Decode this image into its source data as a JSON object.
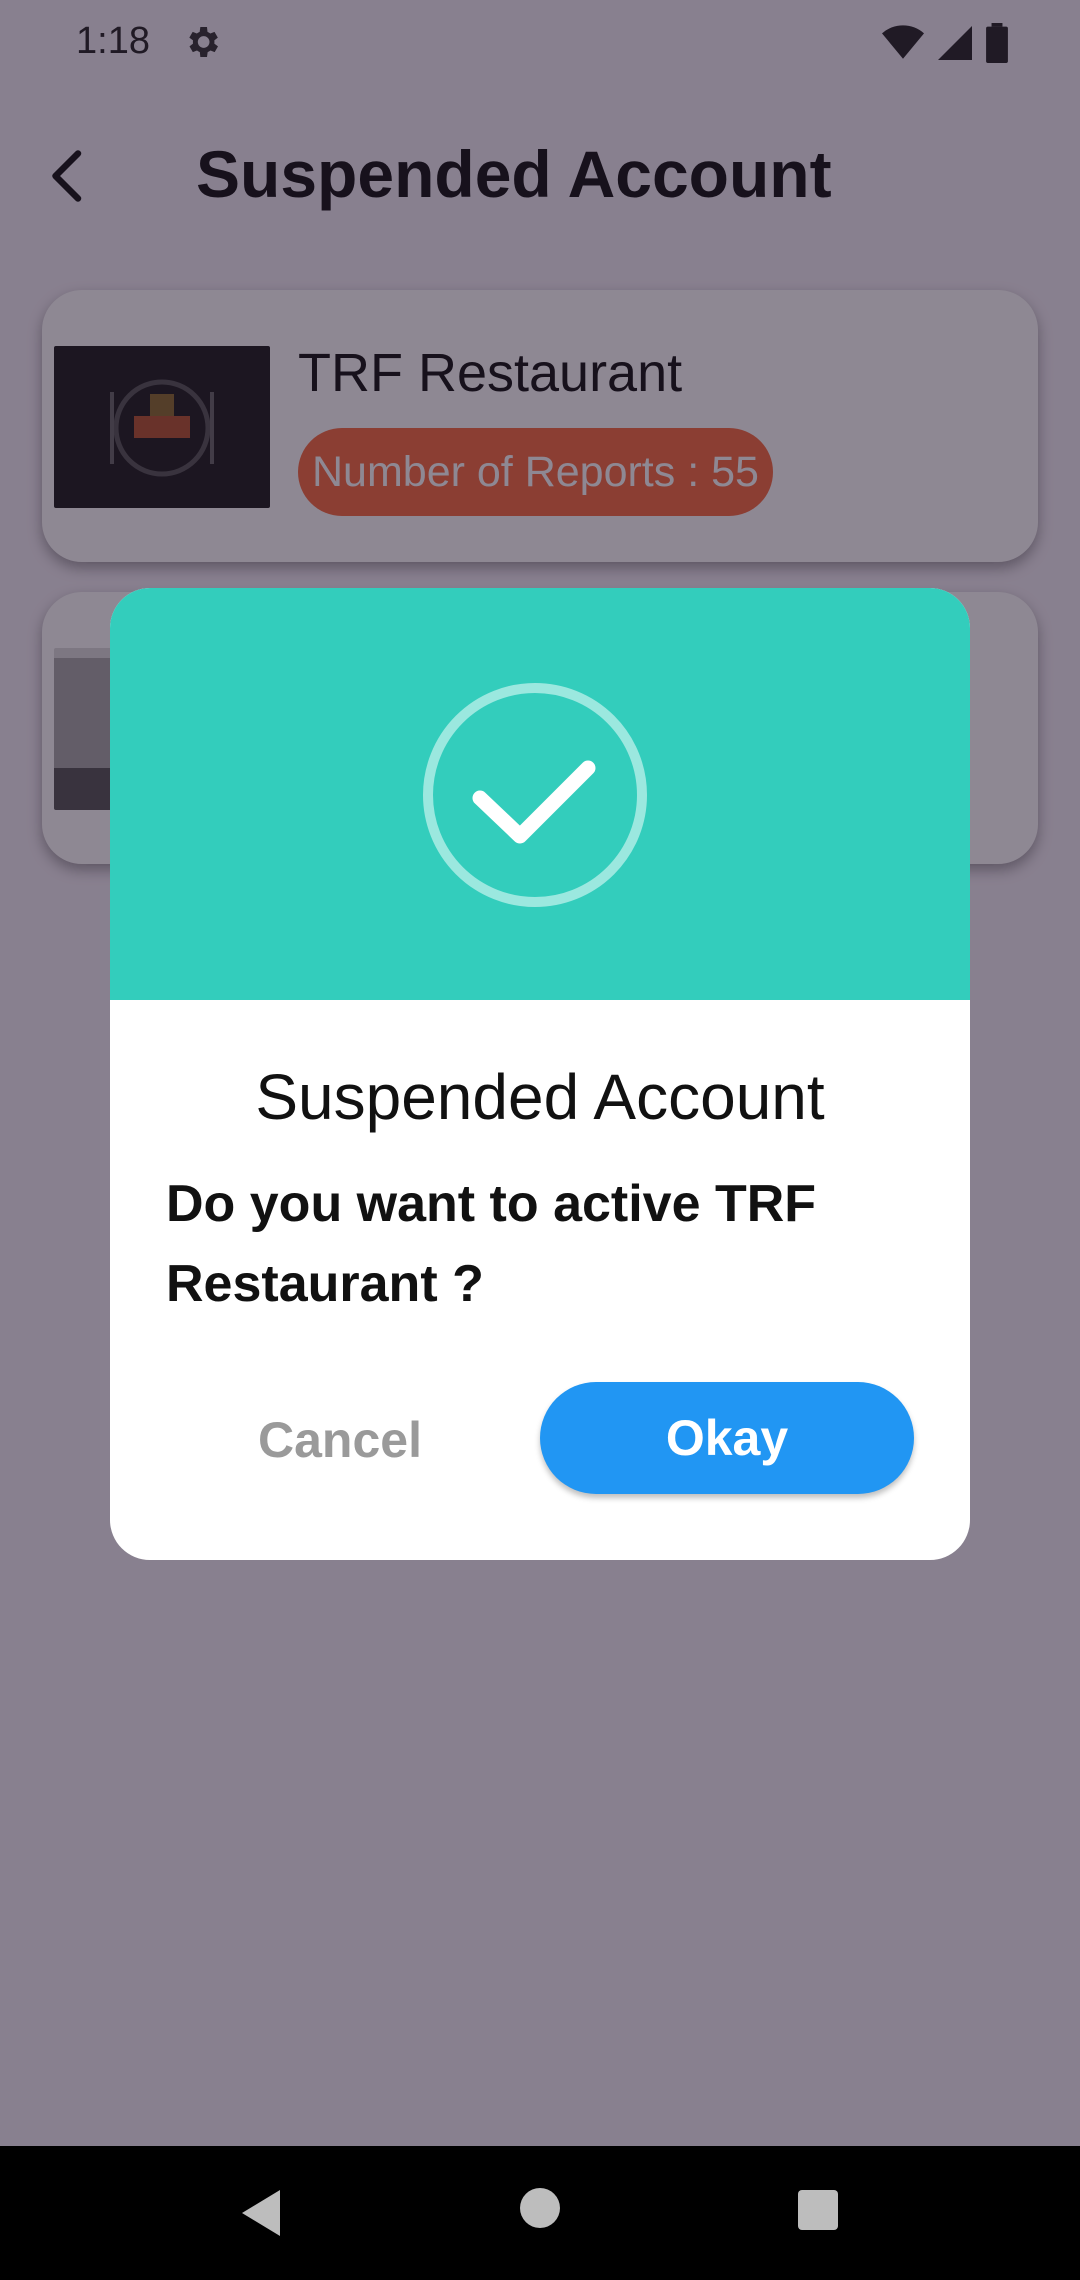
{
  "status_bar": {
    "time": "1:18",
    "icons": [
      "gear-icon",
      "wifi-icon",
      "signal-icon",
      "battery-icon"
    ]
  },
  "app_bar": {
    "title": "Suspended Account",
    "back_icon": "back-arrow-icon"
  },
  "cards": [
    {
      "name": "TRF Restaurant",
      "reports_label": "Number of Reports : 55",
      "thumbnail": "restaurant-logo-image"
    },
    {
      "name": "",
      "reports_label": "",
      "thumbnail": "street-building-image"
    }
  ],
  "dialog": {
    "header_icon": "check-circle-icon",
    "title": "Suspended Account",
    "message": "Do you want to active TRF Restaurant  ?",
    "cancel_label": "Cancel",
    "okay_label": "Okay"
  },
  "colors": {
    "dialog_header": "#33cdbc",
    "okay_button": "#2196f3",
    "report_badge": "#f86b3f",
    "scrim": "rgba(30,18,40,0.5)"
  },
  "nav_bar": {
    "icons": [
      "nav-back-icon",
      "nav-home-icon",
      "nav-recents-icon"
    ]
  }
}
